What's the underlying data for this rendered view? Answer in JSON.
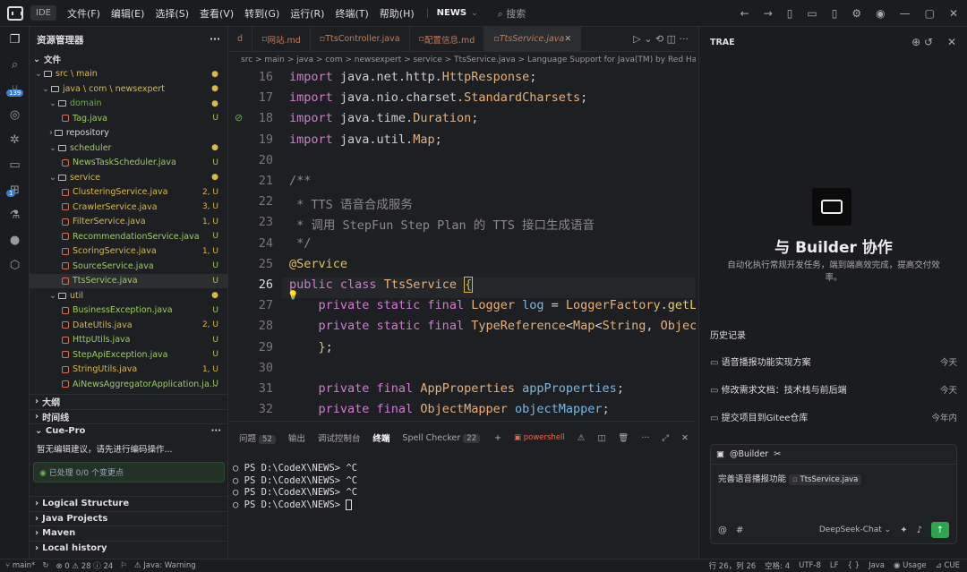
{
  "topbar": {
    "badge": "IDE",
    "menus": [
      "文件(F)",
      "编辑(E)",
      "选择(S)",
      "查看(V)",
      "转到(G)",
      "运行(R)",
      "终端(T)",
      "帮助(H)"
    ],
    "project": "NEWS",
    "search": "搜索"
  },
  "activity": {
    "badge": "139",
    "badge2": "1"
  },
  "explorer": {
    "title": "资源管理器",
    "section": "文件",
    "rows": [
      {
        "indent": 6,
        "kind": "folder",
        "label": "src \\ main",
        "color": "y",
        "status": "●"
      },
      {
        "indent": 14,
        "kind": "folder",
        "label": "java \\ com \\ newsexpert",
        "color": "y",
        "status": "●"
      },
      {
        "indent": 22,
        "kind": "folder",
        "label": "domain",
        "color": "g",
        "status": "●"
      },
      {
        "indent": 36,
        "kind": "file",
        "label": "Tag.java",
        "color": "fg",
        "status": "U"
      },
      {
        "indent": 22,
        "kind": "folderc",
        "label": "repository",
        "color": "fw",
        "status": ""
      },
      {
        "indent": 22,
        "kind": "folder",
        "label": "scheduler",
        "color": "fg",
        "status": "●"
      },
      {
        "indent": 36,
        "kind": "file",
        "label": "NewsTaskScheduler.java",
        "color": "fg",
        "status": "U"
      },
      {
        "indent": 22,
        "kind": "folder",
        "label": "service",
        "color": "y",
        "status": "●"
      },
      {
        "indent": 36,
        "kind": "file",
        "label": "ClusteringService.java",
        "color": "y",
        "status": "2, U"
      },
      {
        "indent": 36,
        "kind": "file",
        "label": "CrawlerService.java",
        "color": "y",
        "status": "3, U"
      },
      {
        "indent": 36,
        "kind": "file",
        "label": "FilterService.java",
        "color": "y",
        "status": "1, U"
      },
      {
        "indent": 36,
        "kind": "file",
        "label": "RecommendationService.java",
        "color": "fg",
        "status": "U"
      },
      {
        "indent": 36,
        "kind": "file",
        "label": "ScoringService.java",
        "color": "y",
        "status": "1, U"
      },
      {
        "indent": 36,
        "kind": "file",
        "label": "SourceService.java",
        "color": "fg",
        "status": "U"
      },
      {
        "indent": 36,
        "kind": "file",
        "label": "TtsService.java",
        "color": "fg",
        "status": "U",
        "selected": true
      },
      {
        "indent": 22,
        "kind": "folder",
        "label": "util",
        "color": "y",
        "status": "●"
      },
      {
        "indent": 36,
        "kind": "file",
        "label": "BusinessException.java",
        "color": "fg",
        "status": "U"
      },
      {
        "indent": 36,
        "kind": "file",
        "label": "DateUtils.java",
        "color": "y",
        "status": "2, U"
      },
      {
        "indent": 36,
        "kind": "file",
        "label": "HttpUtils.java",
        "color": "fg",
        "status": "U"
      },
      {
        "indent": 36,
        "kind": "file",
        "label": "StepApiException.java",
        "color": "fg",
        "status": "U"
      },
      {
        "indent": 36,
        "kind": "file",
        "label": "StringUtils.java",
        "color": "y",
        "status": "1, U"
      },
      {
        "indent": 36,
        "kind": "file",
        "label": "AiNewsAggregatorApplication.ja...",
        "color": "fg",
        "status": "U"
      }
    ],
    "sections": [
      "大纲",
      "时间线"
    ],
    "cue": {
      "title": "Cue-Pro",
      "msg": "暂无编辑建议，请先进行编码操作...",
      "processed": "已处理 0/0 个变更点"
    },
    "bottom": [
      "Logical Structure",
      "Java Projects",
      "Maven",
      "Local history"
    ]
  },
  "tabs": [
    "d",
    "网站.md",
    "TtsController.java",
    "配置信息.md",
    "TtsService.java"
  ],
  "breadcrumb": "src  >  main  >  java  >  com  >  newsexpert  >  service  >  TtsService.java  >  Language Support for Java(TM) by Red Hat",
  "code": [
    {
      "n": "16",
      "html": "<span class='kw'>import</span> java.net.http.<span class='ty'>HttpResponse</span>;"
    },
    {
      "n": "17",
      "html": "<span class='kw'>import</span> java.nio.charset.<span class='ty'>StandardCharsets</span>;"
    },
    {
      "n": "18",
      "html": "<span class='kw'>import</span> java.time.<span class='ty'>Duration</span>;"
    },
    {
      "n": "19",
      "html": "<span class='kw'>import</span> java.util.<span class='ty'>Map</span>;"
    },
    {
      "n": "20",
      "html": ""
    },
    {
      "n": "21",
      "html": "<span class='cm'>/**</span>"
    },
    {
      "n": "22",
      "html": "<span class='cm'> * TTS 语音合成服务</span>"
    },
    {
      "n": "23",
      "html": "<span class='cm'> * 调用 StepFun Step Plan 的 TTS 接口生成语音</span>"
    },
    {
      "n": "24",
      "html": "<span class='cm'> */</span>"
    },
    {
      "n": "25",
      "html": "<span class='an'>@Service</span>"
    },
    {
      "n": "26",
      "html": "<span class='kw'>public class</span> <span class='ty'>TtsService</span> <span style='border:1px solid #d7b84d;color:#d7b84d'>{</span>"
    },
    {
      "n": "27",
      "html": "    <span class='kw'>private static final</span> <span class='ty'>Logger</span> <span class='id'>log</span> = <span class='ty'>LoggerFactory</span>.<span class='fn'>getL</span>"
    },
    {
      "n": "28",
      "html": "    <span class='kw'>private static final</span> <span class='ty'>TypeReference</span>&lt;<span class='ty'>Map</span>&lt;<span class='ty'>String</span>, <span class='ty'>Objec</span>"
    },
    {
      "n": "29",
      "html": "    <span class='an'>}</span>;"
    },
    {
      "n": "30",
      "html": ""
    },
    {
      "n": "31",
      "html": "    <span class='kw'>private final</span> <span class='ty'>AppProperties</span> <span class='id'>appProperties</span>;"
    },
    {
      "n": "32",
      "html": "    <span class='kw'>private final</span> <span class='ty'>ObjectMapper</span> <span class='id'>objectMapper</span>;"
    }
  ],
  "panel": {
    "tabs": [
      "问题",
      "输出",
      "调试控制台",
      "终端",
      "Spell Checker"
    ],
    "problems": "52",
    "spell": "22",
    "shell": "powershell",
    "lines": [
      "PS D:\\CodeX\\NEWS> ^C",
      "PS D:\\CodeX\\NEWS> ^C",
      "PS D:\\CodeX\\NEWS> ^C",
      "PS D:\\CodeX\\NEWS> "
    ]
  },
  "right": {
    "title": "TRAE",
    "heading": "与 Builder 协作",
    "sub": "自动化执行常规开发任务，端到端高效完成，提高交付效率。",
    "histTitle": "历史记录",
    "history": [
      {
        "label": "语音播报功能实现方案",
        "time": "今天"
      },
      {
        "label": "修改需求文档：技术栈与前后端",
        "time": "今天"
      },
      {
        "label": "提交项目到Gitee仓库",
        "time": "今年内"
      }
    ],
    "agent": "@Builder",
    "input": "完善语音播报功能",
    "chip": "TtsService.java",
    "model": "DeepSeek-Chat"
  },
  "status": {
    "branch": "main*",
    "errors": "0",
    "warnings": "28",
    "info": "24",
    "java": "Java: Warning",
    "pos": "行 26，列 26",
    "spaces": "空格: 4",
    "enc": "UTF-8",
    "eol": "LF",
    "lang": "Java",
    "usage": "Usage",
    "cue": "CUE"
  }
}
